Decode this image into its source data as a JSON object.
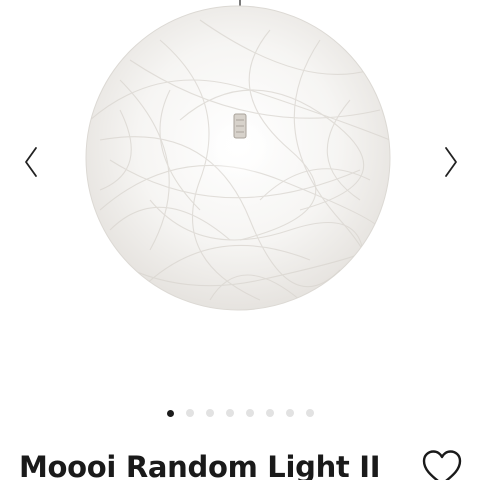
{
  "product": {
    "title": "Moooi Random Light II"
  },
  "gallery": {
    "slide_count": 8,
    "active_index": 0
  },
  "icons": {
    "prev": "chevron-left-icon",
    "next": "chevron-right-icon",
    "favorite": "heart-outline-icon"
  },
  "colors": {
    "text": "#1a1a1a",
    "dot_active": "#1b1b1b",
    "dot_inactive": "#e2e2e2",
    "lamp": "#f1efec"
  }
}
